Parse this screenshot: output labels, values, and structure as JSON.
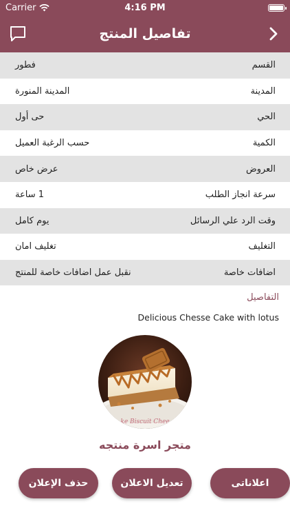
{
  "status_bar": {
    "carrier": "Carrier",
    "time": "4:16 PM"
  },
  "nav": {
    "title": "تفاصيل المنتج",
    "back_icon": "chevron-right-icon",
    "chat_icon": "chat-icon"
  },
  "rows": [
    {
      "label": "القسم",
      "value": "فطور"
    },
    {
      "label": "المدينة",
      "value": "المدينة المنورة"
    },
    {
      "label": "الحي",
      "value": "حى أول"
    },
    {
      "label": "الكمية",
      "value": "حسب الرغبة العميل"
    },
    {
      "label": "العروض",
      "value": "عرض خاص"
    },
    {
      "label": "سرعة انجاز الطلب",
      "value": "1 ساعة"
    },
    {
      "label": "وقت الرد علي الرسائل",
      "value": "يوم كامل"
    },
    {
      "label": "التغليف",
      "value": "تغليف امان"
    },
    {
      "label": "اضافات خاصة",
      "value": "نقبل عمل اضافات خاصة للمنتج"
    }
  ],
  "details": {
    "title": "التفاصيل",
    "text": "Delicious Chesse Cake with lotus"
  },
  "product": {
    "image_caption": "ke Biscuit Chee",
    "store_name": "متجر اسرة منتجه"
  },
  "buttons": {
    "delete": "حذف الإعلان",
    "edit": "تعديل الاعلان",
    "ads": "اعلاناتى"
  },
  "colors": {
    "primary": "#8a4a5a",
    "row_shade": "#e3e3e3"
  }
}
